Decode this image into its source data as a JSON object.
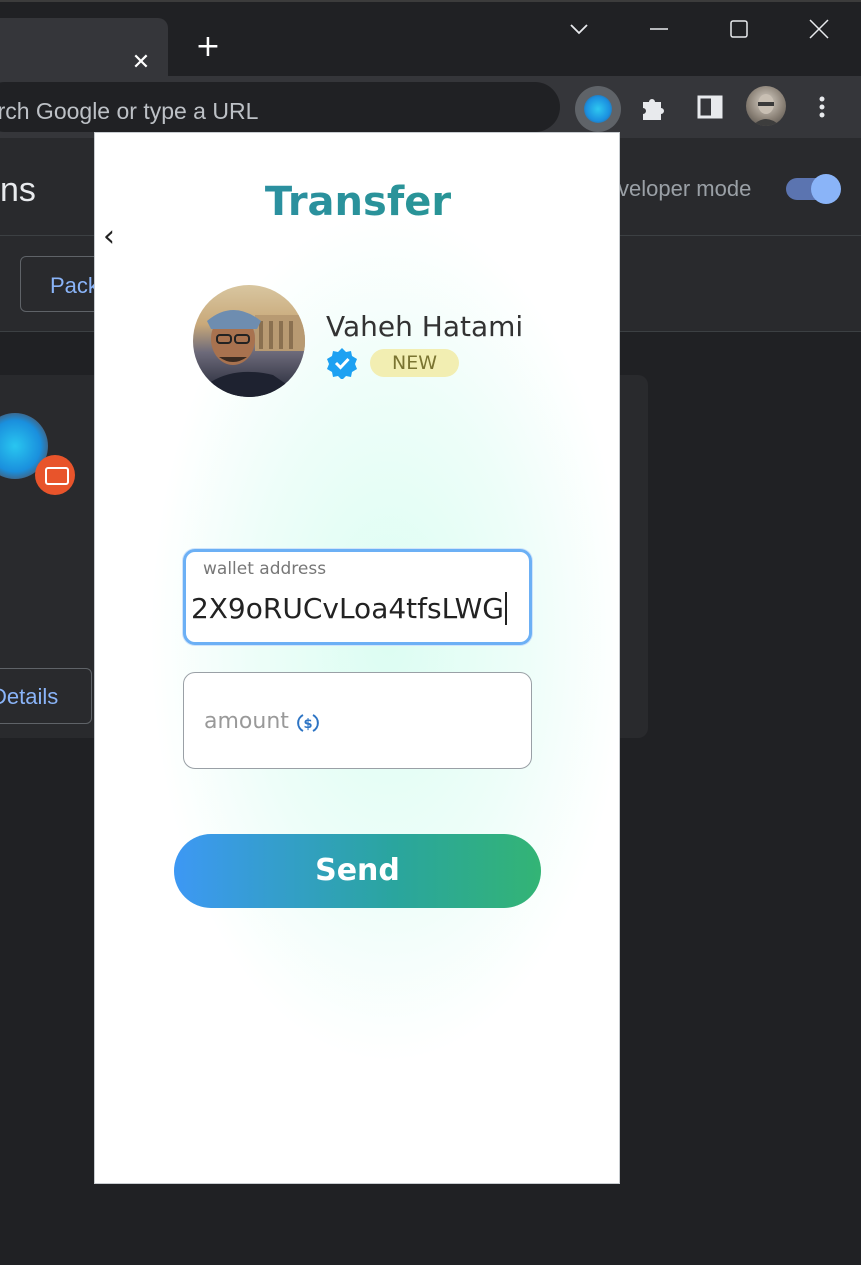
{
  "browser": {
    "tab_close_glyph": "✕",
    "new_tab_glyph": "+",
    "omnibox_text": "earch Google or type a URL"
  },
  "extensions_page": {
    "title": "ns",
    "developer_mode_label": "veloper mode",
    "developer_mode_enabled": true,
    "pack_button_label": "Pack",
    "details_button_label": "Details"
  },
  "popup": {
    "title": "Transfer",
    "back_glyph": "‹",
    "user": {
      "name": "Vaheh Hatami",
      "badge": "NEW",
      "verified": true
    },
    "wallet": {
      "label": "wallet address",
      "value": "2X9oRUCvLoa4tfsLWG"
    },
    "amount": {
      "placeholder": "amount"
    },
    "send_label": "Send"
  },
  "colors": {
    "accent_blue": "#3d98f4",
    "accent_green": "#33b475",
    "title_teal": "#2d8aa8",
    "badge_bg": "#f2eeb2",
    "verified_blue": "#1da1f2"
  }
}
